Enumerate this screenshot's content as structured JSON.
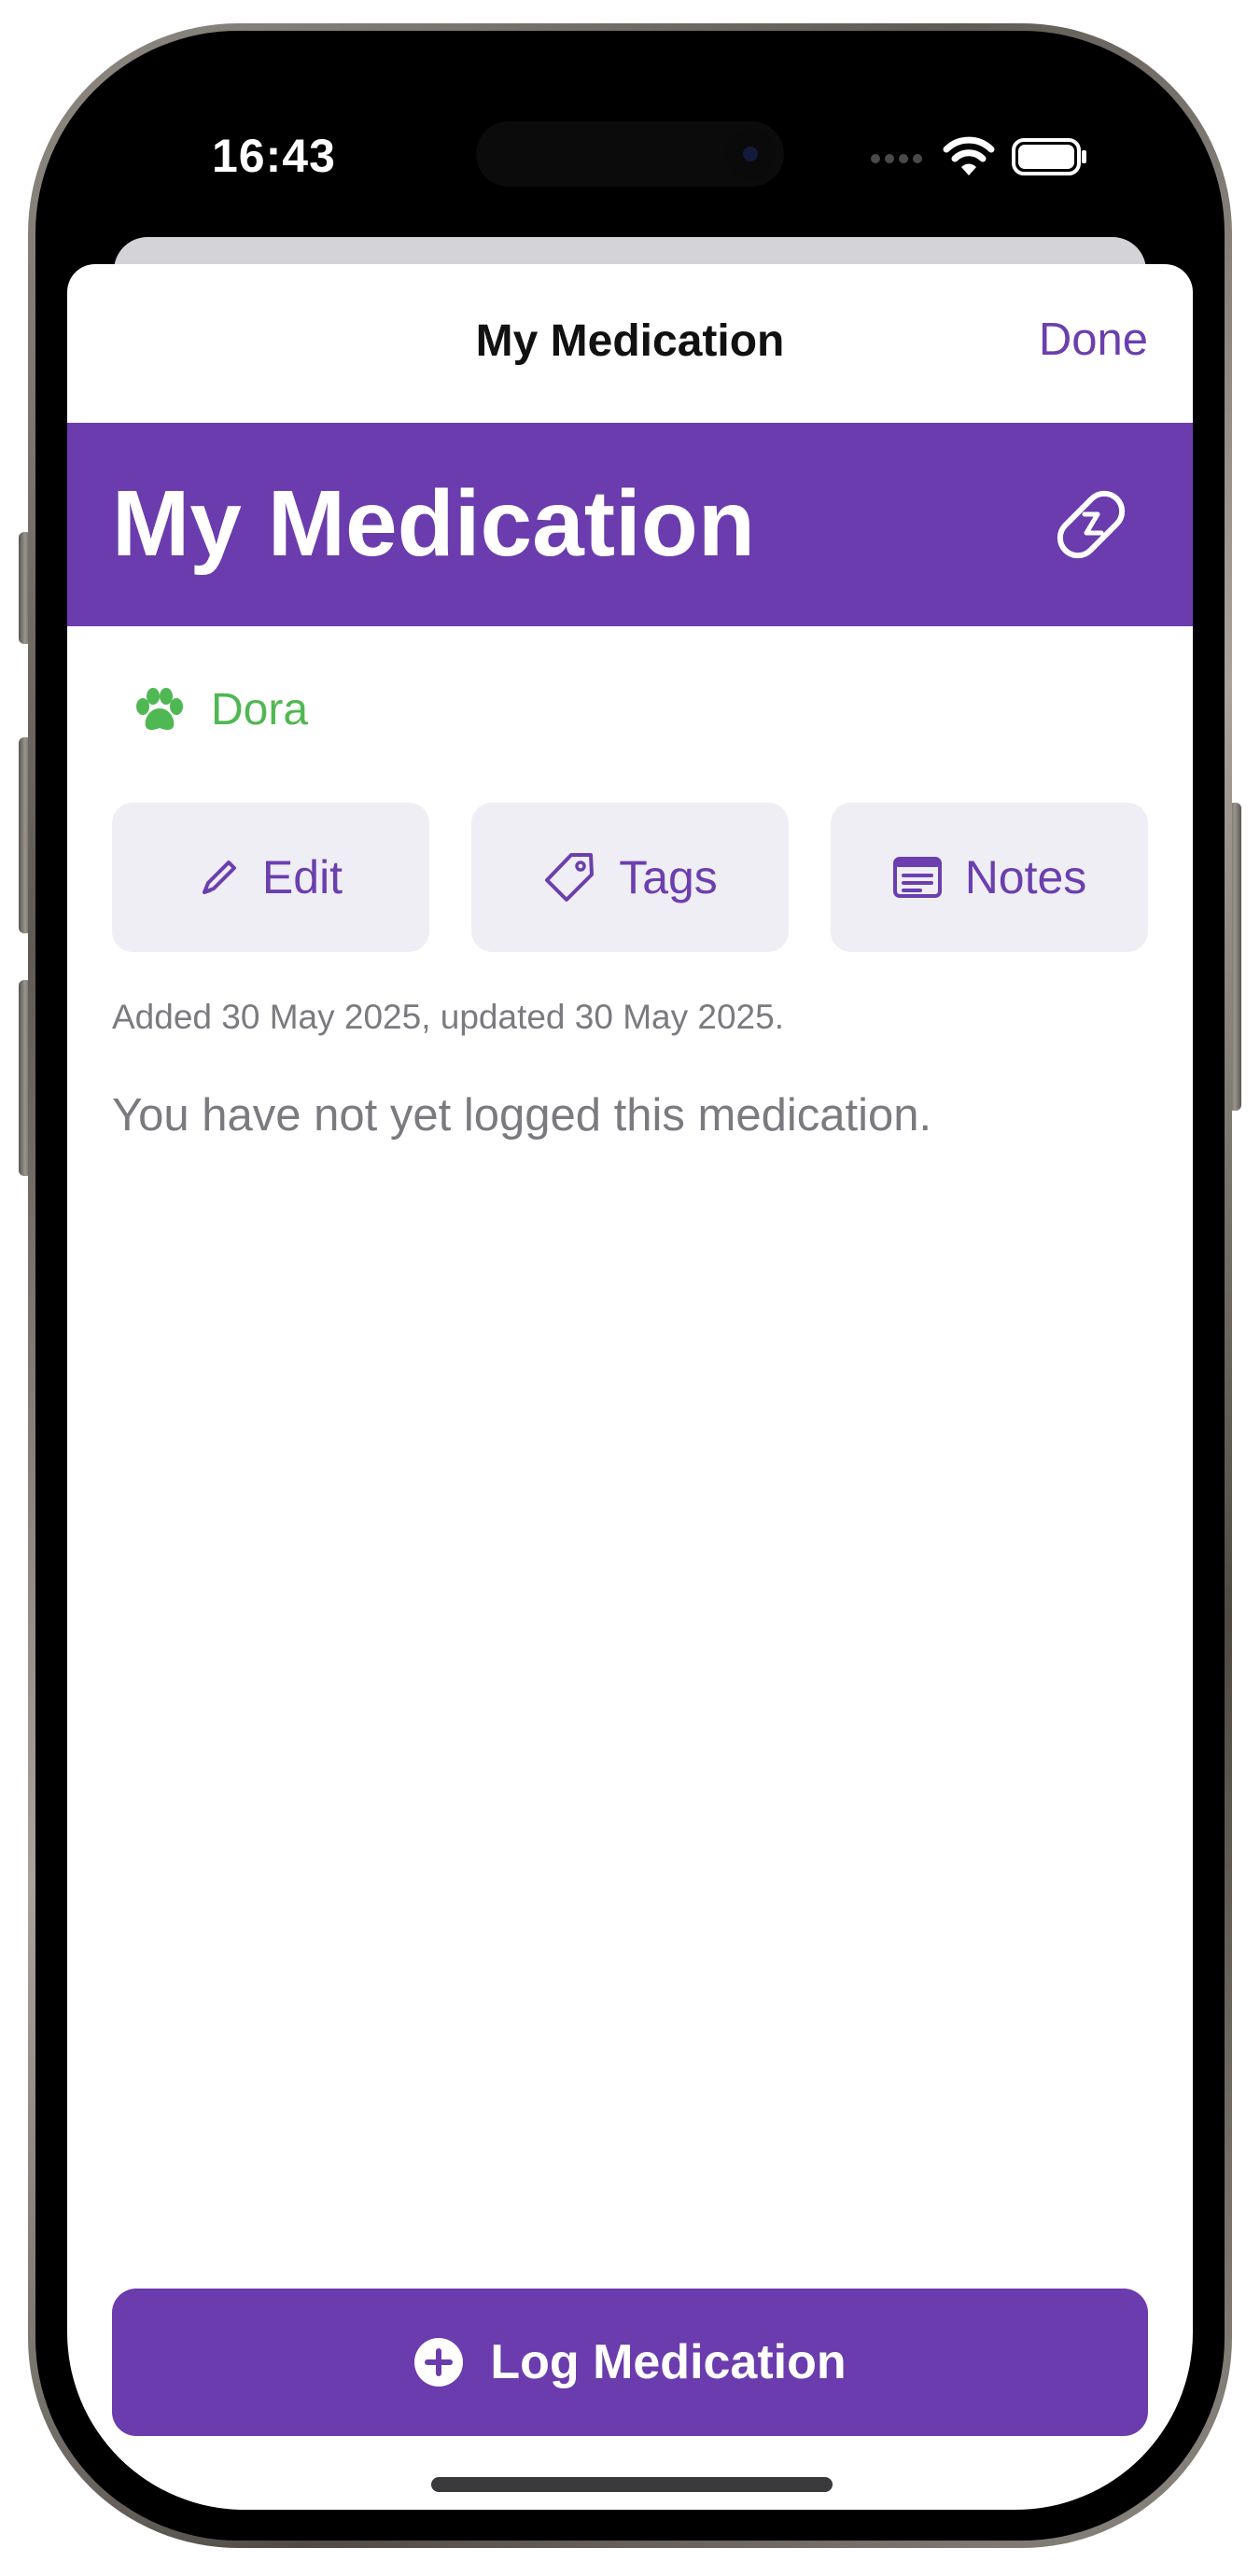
{
  "status_bar": {
    "time": "16:43"
  },
  "nav": {
    "title": "My Medication",
    "done_label": "Done"
  },
  "header": {
    "title": "My Medication",
    "icon": "pill-icon",
    "background": "#6b3cad"
  },
  "pet": {
    "icon": "paw-icon",
    "name": "Dora",
    "color": "#4fb852"
  },
  "actions": [
    {
      "label": "Edit",
      "icon": "pencil-icon"
    },
    {
      "label": "Tags",
      "icon": "tag-icon"
    },
    {
      "label": "Notes",
      "icon": "notes-icon"
    }
  ],
  "meta": {
    "added_updated": "Added 30 May 2025, updated 30 May 2025."
  },
  "empty_state": {
    "message": "You have not yet logged this medication."
  },
  "log_button": {
    "label": "Log Medication",
    "icon": "plus-circle-icon"
  },
  "colors": {
    "accent": "#6b3fae",
    "button_bg": "#efeef4",
    "secondary_text": "#7a7a80"
  }
}
